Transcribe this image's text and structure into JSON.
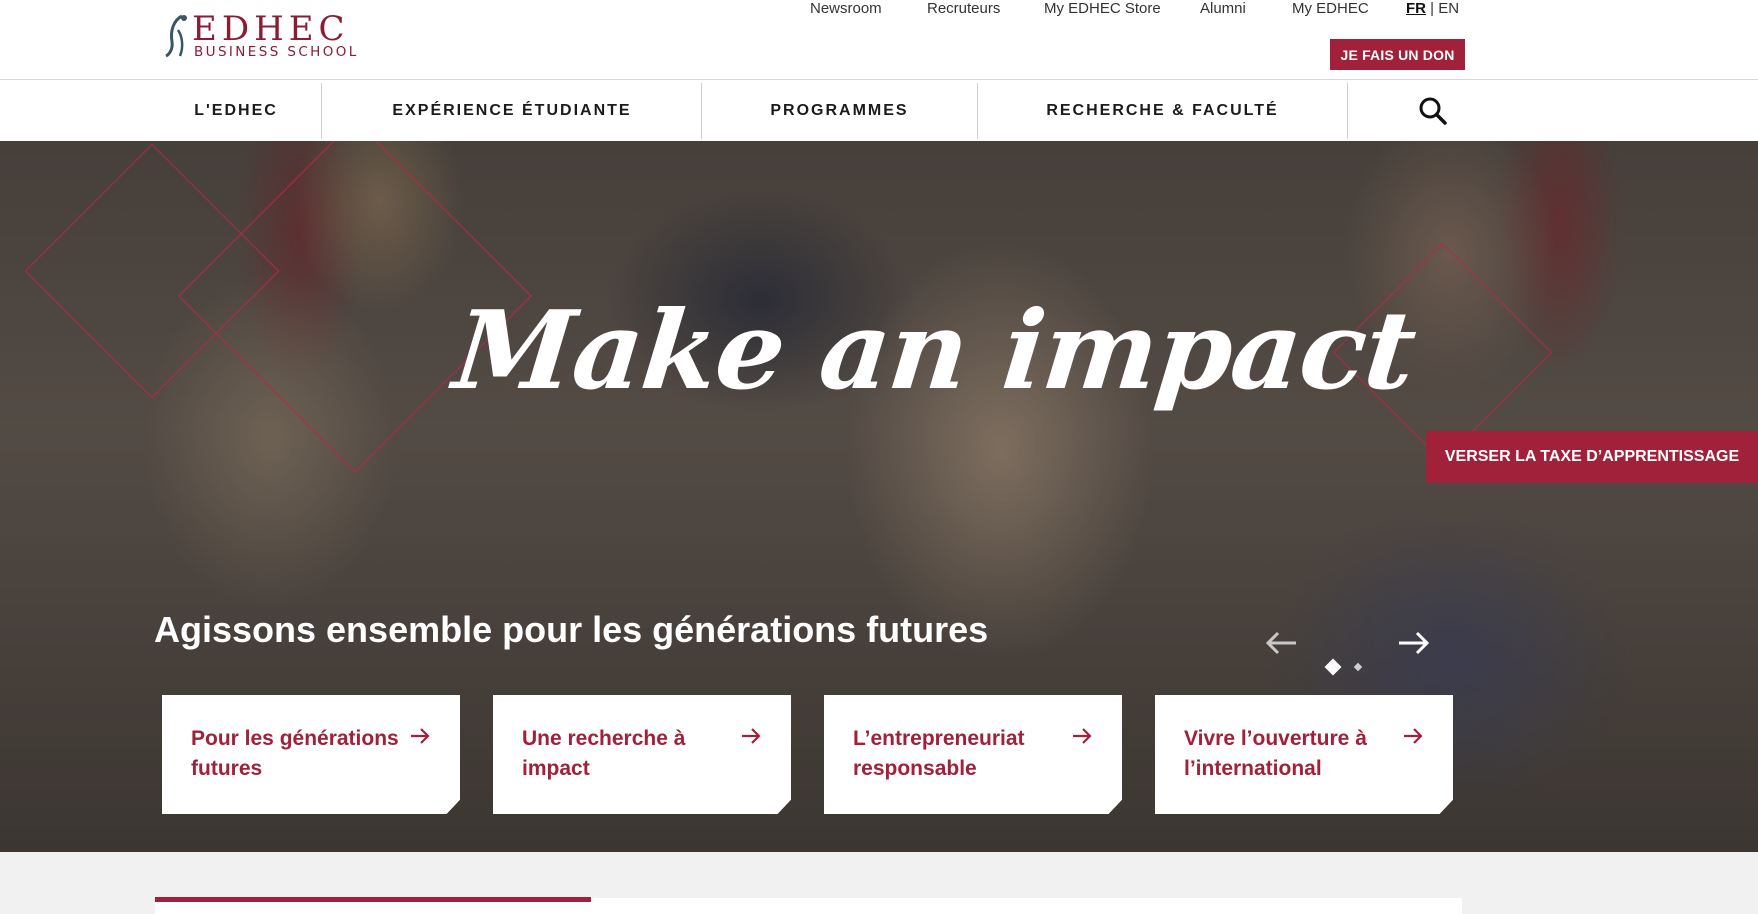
{
  "brand": {
    "name": "EDHEC",
    "subname": "BUSINESS SCHOOL",
    "color": "#a1213a"
  },
  "top_links": [
    "Newsroom",
    "Recruteurs",
    "My EDHEC Store",
    "Alumni",
    "My EDHEC"
  ],
  "language": {
    "fr": "FR",
    "separator": "|",
    "en": "EN"
  },
  "donate_label": "JE FAIS UN DON",
  "nav": {
    "items": [
      "L'EDHEC",
      "EXPÉRIENCE ÉTUDIANTE",
      "PROGRAMMES",
      "RECHERCHE & FACULTÉ"
    ],
    "search_icon": "search-icon"
  },
  "hero": {
    "headline": "Make an impact",
    "subline": "Agissons ensemble pour les générations futures",
    "side_cta": "VERSER LA TAXE D’APPRENTISSAGE",
    "slides": 2,
    "active_slide": 1,
    "cards": [
      "Pour les générations futures",
      "Une recherche à impact",
      "L’entrepreneuriat responsable",
      "Vivre l’ouverture à l’international"
    ]
  }
}
